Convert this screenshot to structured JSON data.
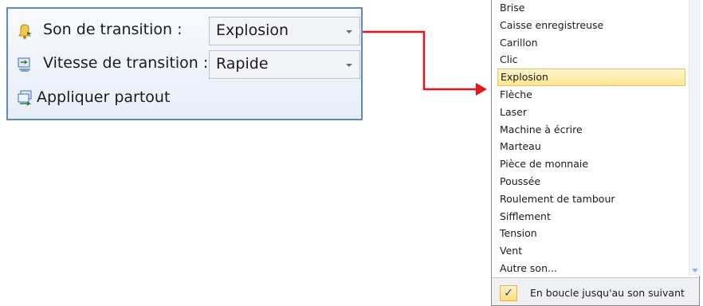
{
  "panel": {
    "sound_label": "Son de transition :",
    "sound_value": "Explosion",
    "speed_label": "Vitesse de transition :",
    "speed_value": "Rapide",
    "apply_all_label": "Appliquer partout"
  },
  "dropdown": {
    "items": [
      "Brise",
      "Caisse enregistreuse",
      "Carillon",
      "Clic",
      "Explosion",
      "Flèche",
      "Laser",
      "Machine à écrire",
      "Marteau",
      "Pièce de monnaie",
      "Poussée",
      "Roulement de tambour",
      "Sifflement",
      "Tension",
      "Vent",
      "Autre son..."
    ],
    "selected": "Explosion",
    "loop_option": {
      "label": "En boucle jusqu'au son suivant",
      "checked": true
    }
  },
  "colors": {
    "panel_border": "#5b89c5",
    "connector_arrow": "#e8141b",
    "selection_highlight": "#fde690"
  }
}
